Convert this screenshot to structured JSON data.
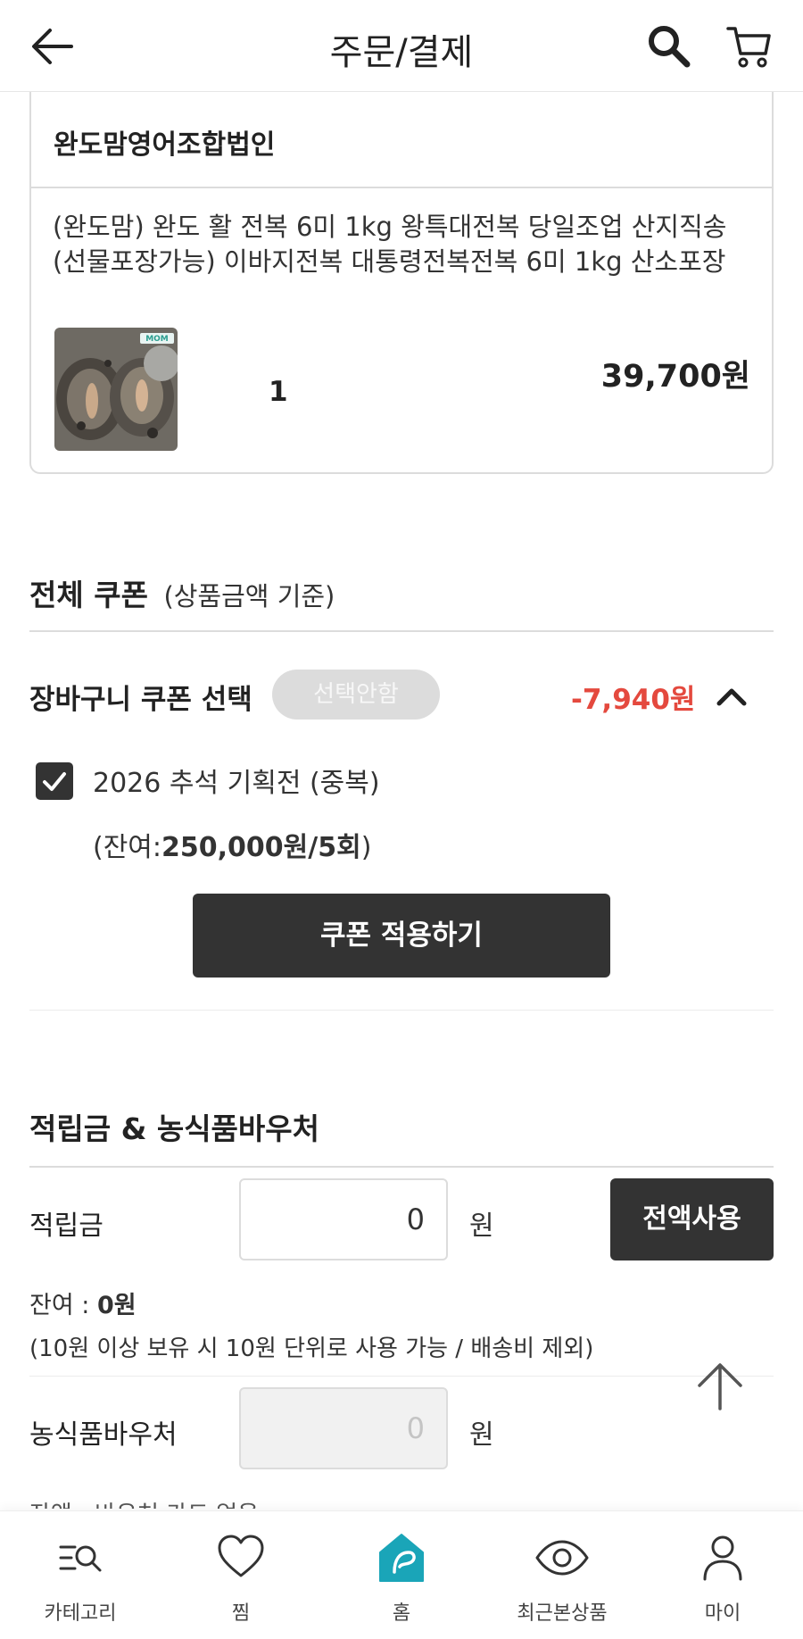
{
  "header": {
    "title": "주문/결제"
  },
  "order": {
    "seller": "완도맘영어조합법인",
    "product_name": "(완도맘) 완도 활 전복 6미 1kg 왕특대전복 당일조업 산지직송 (선물포장가능) 이바지전복 대통령전복전복 6미 1kg 산소포장",
    "thumb_logo": "MOM 완도맘",
    "quantity": "1",
    "price": "39,700원"
  },
  "coupon": {
    "title": "전체 쿠폰",
    "subtitle": "(상품금액 기준)",
    "row_label": "장바구니 쿠폰 선택",
    "select_state": "선택안함",
    "discount": "-7,940원",
    "item_name": "2026 추석 기획전 (중복)",
    "remain_prefix": "(잔여:",
    "remain_value": "250,000원/5회",
    "remain_suffix": ")",
    "apply_label": "쿠폰 적용하기",
    "checked": true
  },
  "points": {
    "title": "적립금 & 농식품바우처",
    "points_label": "적립금",
    "points_value": "0",
    "won": "원",
    "use_all_label": "전액사용",
    "remain_prefix": "잔여 : ",
    "remain_value": "0원",
    "note": "(10원 이상 보유 시 10원 단위로 사용 가능 / 배송비 제외)",
    "voucher_label": "농식품바우처",
    "voucher_value": "0",
    "voucher_remain_partial": "잔액 : 바우처 카드 없음"
  },
  "bottom_nav": [
    {
      "label": "카테고리",
      "icon": "category-search-icon"
    },
    {
      "label": "찜",
      "icon": "heart-icon"
    },
    {
      "label": "홈",
      "icon": "home-icon"
    },
    {
      "label": "최근본상품",
      "icon": "eye-icon"
    },
    {
      "label": "마이",
      "icon": "person-icon"
    }
  ],
  "colors": {
    "discount": "#e4493e",
    "dark_button": "#333333",
    "home_teal": "#1aa5b8"
  }
}
